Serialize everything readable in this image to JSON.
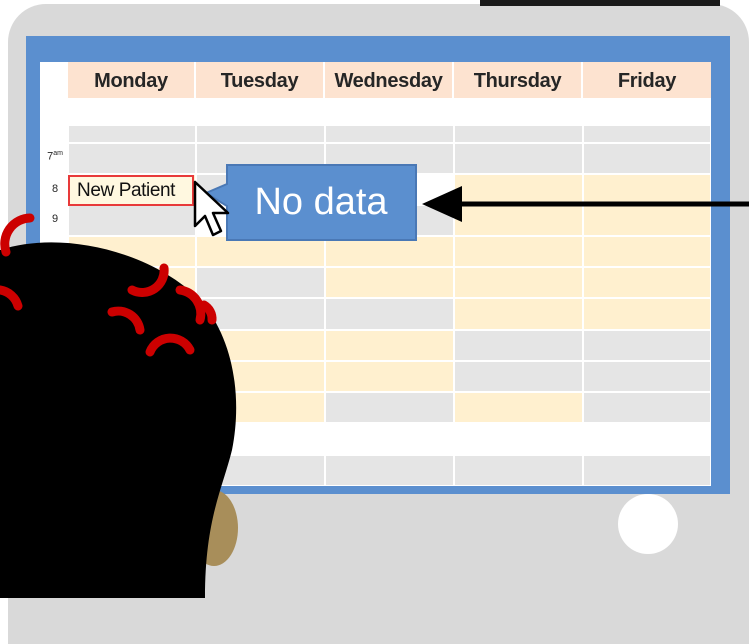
{
  "calendar": {
    "days": [
      "Monday",
      "Tuesday",
      "Wednesday",
      "Thursday",
      "Friday"
    ],
    "times": [
      {
        "hour": "7",
        "suffix": "am"
      },
      {
        "hour": "8",
        "suffix": ""
      },
      {
        "hour": "9",
        "suffix": ""
      }
    ],
    "event": {
      "label": "New Patient"
    }
  },
  "tooltip": {
    "label": "No data"
  },
  "colors": {
    "device": "#d9d9d9",
    "screen_border": "#5b8fcf",
    "day_header": "#fde3d0",
    "slot_grey": "#e5e5e5",
    "slot_peach": "#fff0cf",
    "tooltip": "#5b8fcf",
    "event_border": "#e83a3a",
    "stress_marks": "#cc0000"
  },
  "icons": [
    "mouse-cursor-icon",
    "arrow-left-icon",
    "stress-mark-icon",
    "home-button-icon"
  ]
}
